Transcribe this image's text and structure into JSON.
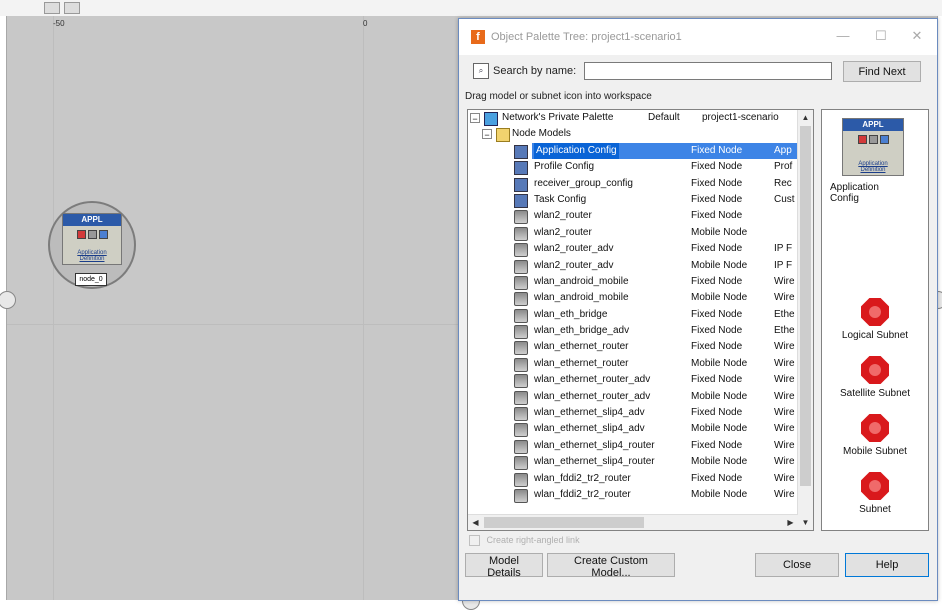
{
  "workspace": {
    "ruler_labels": [
      "-50",
      "0"
    ],
    "node": {
      "icon_title": "APPL",
      "icon_caption": "Application Definition",
      "label": "node_0"
    }
  },
  "dialog": {
    "title": "Object Palette Tree: project1-scenario1",
    "app_icon": "f",
    "window_controls": {
      "minimize": "—",
      "maximize": "☐",
      "close": "✕"
    },
    "search_label": "Search by name:",
    "search_value": "",
    "find_next": "Find Next",
    "drag_hint": "Drag model or subnet icon into workspace",
    "tree": {
      "root": {
        "name": "Network's Private Palette",
        "type": "Default",
        "desc": "project1-scenario"
      },
      "group": {
        "name": "Node Models"
      },
      "rows": [
        {
          "name": "Application Config",
          "type": "Fixed Node",
          "desc": "App",
          "selected": true,
          "icon": "cfg-icon"
        },
        {
          "name": "Profile Config",
          "type": "Fixed Node",
          "desc": "Prof",
          "icon": "cfg-icon"
        },
        {
          "name": "receiver_group_config",
          "type": "Fixed Node",
          "desc": "Rec",
          "icon": "cfg-icon"
        },
        {
          "name": "Task Config",
          "type": "Fixed Node",
          "desc": "Cust",
          "icon": "cfg-icon"
        },
        {
          "name": "wlan2_router",
          "type": "Fixed Node",
          "desc": "",
          "icon": "router-icon"
        },
        {
          "name": "wlan2_router",
          "type": "Mobile Node",
          "desc": "",
          "icon": "router-icon"
        },
        {
          "name": "wlan2_router_adv",
          "type": "Fixed Node",
          "desc": "IP F",
          "icon": "router-icon"
        },
        {
          "name": "wlan2_router_adv",
          "type": "Mobile Node",
          "desc": "IP F",
          "icon": "router-icon"
        },
        {
          "name": "wlan_android_mobile",
          "type": "Fixed Node",
          "desc": "Wire",
          "icon": "phone-icon"
        },
        {
          "name": "wlan_android_mobile",
          "type": "Mobile Node",
          "desc": "Wire",
          "icon": "phone-icon"
        },
        {
          "name": "wlan_eth_bridge",
          "type": "Fixed Node",
          "desc": "Ethe",
          "icon": "bridge-icon"
        },
        {
          "name": "wlan_eth_bridge_adv",
          "type": "Fixed Node",
          "desc": "Ethe",
          "icon": "bridge-icon"
        },
        {
          "name": "wlan_ethernet_router",
          "type": "Fixed Node",
          "desc": "Wire",
          "icon": "router-icon"
        },
        {
          "name": "wlan_ethernet_router",
          "type": "Mobile Node",
          "desc": "Wire",
          "icon": "router-icon"
        },
        {
          "name": "wlan_ethernet_router_adv",
          "type": "Fixed Node",
          "desc": "Wire",
          "icon": "router-icon"
        },
        {
          "name": "wlan_ethernet_router_adv",
          "type": "Mobile Node",
          "desc": "Wire",
          "icon": "router-icon"
        },
        {
          "name": "wlan_ethernet_slip4_adv",
          "type": "Fixed Node",
          "desc": "Wire",
          "icon": "router-icon"
        },
        {
          "name": "wlan_ethernet_slip4_adv",
          "type": "Mobile Node",
          "desc": "Wire",
          "icon": "router-icon"
        },
        {
          "name": "wlan_ethernet_slip4_router",
          "type": "Fixed Node",
          "desc": "Wire",
          "icon": "router-icon"
        },
        {
          "name": "wlan_ethernet_slip4_router",
          "type": "Mobile Node",
          "desc": "Wire",
          "icon": "router-icon"
        },
        {
          "name": "wlan_fddi2_tr2_router",
          "type": "Fixed Node",
          "desc": "Wire",
          "icon": "router-icon"
        },
        {
          "name": "wlan_fddi2_tr2_router",
          "type": "Mobile Node",
          "desc": "Wire",
          "icon": "router-icon"
        }
      ]
    },
    "palette": {
      "preview": {
        "icon_title": "APPL",
        "icon_caption": "Application Definition",
        "label": "Application Config"
      },
      "subnets": [
        "Logical Subnet",
        "Satellite Subnet",
        "Mobile Subnet",
        "Subnet"
      ]
    },
    "checkbox_label": "Create right-angled link",
    "buttons": {
      "model_details": "Model Details",
      "create_custom": "Create Custom Model...",
      "close": "Close",
      "help": "Help"
    }
  }
}
